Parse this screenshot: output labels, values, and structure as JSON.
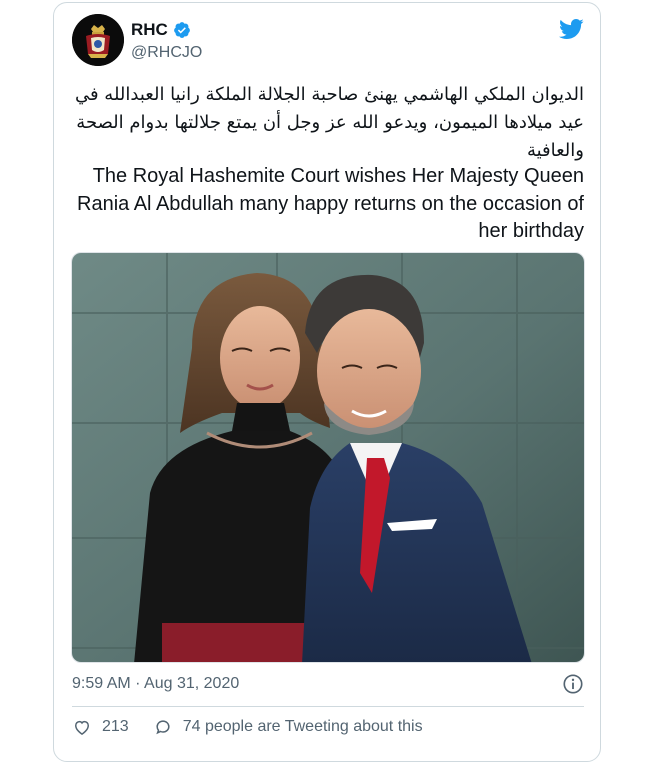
{
  "tweet": {
    "author_name": "RHC",
    "author_handle": "@RHCJO",
    "text_arabic": "الديوان الملكي الهاشمي يهنئ صاحبة الجلالة الملكة رانيا العبدالله في عيد ميلادها الميمون، ويدعو الله عز وجل أن يمتع جلالتها بدوام الصحة والعافية",
    "text_english": "The Royal Hashemite Court wishes Her Majesty Queen Rania Al Abdullah many happy returns on the occasion of her birthday",
    "timestamp": "9:59 AM · Aug 31, 2020",
    "like_count": "213",
    "conversation_text": "74 people are Tweeting about this"
  },
  "colors": {
    "twitter_blue": "#1d9bf0",
    "text_primary": "#0f1419",
    "text_secondary": "#536471",
    "border": "#cfd9de"
  },
  "icons": [
    "verified-badge-icon",
    "twitter-bird-icon",
    "info-icon",
    "heart-icon",
    "speech-bubble-icon"
  ]
}
